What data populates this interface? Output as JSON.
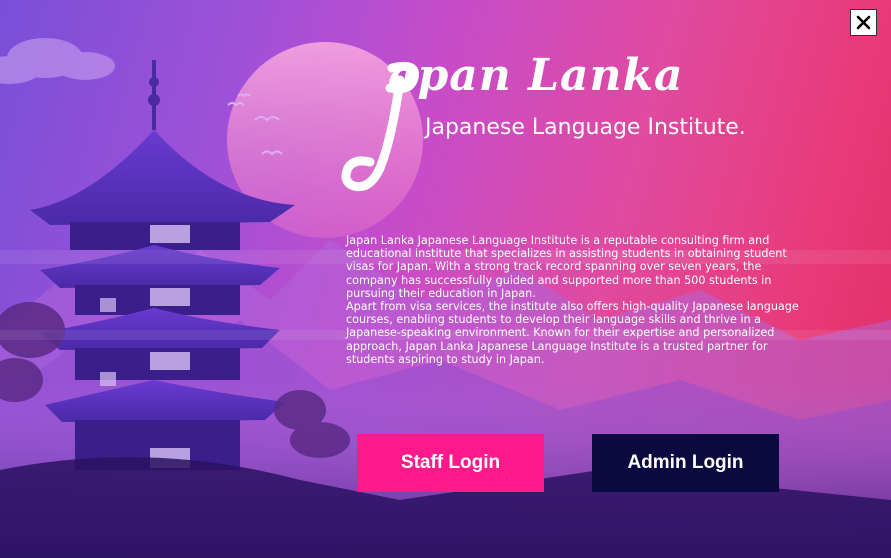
{
  "window": {
    "close_label": "×"
  },
  "brand": {
    "title": "apan Lanka",
    "subtitle": "Japanese Language Institute."
  },
  "about": {
    "paragraph1": "Japan Lanka Japanese Language Institute is a reputable consulting firm and educational institute that specializes in assisting students in obtaining student visas for Japan. With a strong track record spanning over seven years, the company has successfully guided and supported more than 500 students in pursuing their education in Japan.",
    "paragraph2": "Apart from visa services, the institute also offers high-quality Japanese language courses, enabling students to develop their language skills and thrive in a Japanese-speaking environment. Known for their expertise and personalized approach, Japan Lanka Japanese Language Institute is a trusted partner for students aspiring to study in Japan."
  },
  "actions": {
    "staff_login": "Staff Login",
    "admin_login": "Admin Login"
  },
  "colors": {
    "staff_button": "#ff1a8c",
    "admin_button": "#0a0a40"
  }
}
